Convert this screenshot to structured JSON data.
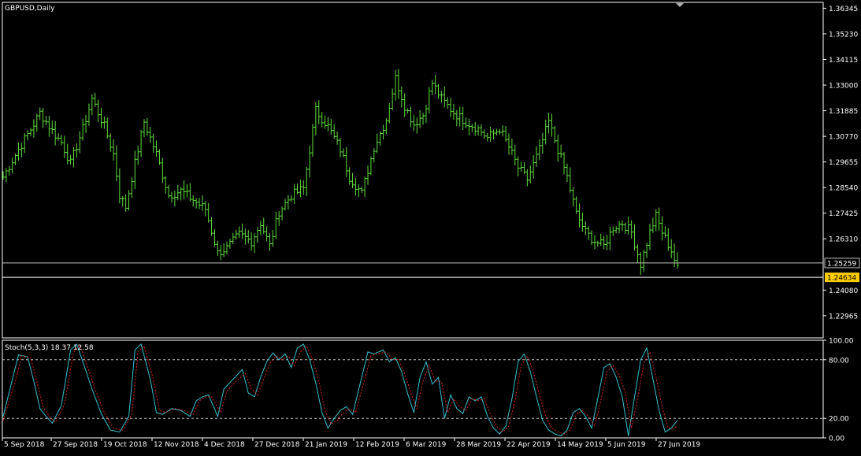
{
  "window": {
    "title": "GBPUSD,Daily"
  },
  "colors": {
    "background": "#000000",
    "foreground": "#ffffff",
    "bar": "#5fdc3b",
    "bid_line": "#c0c0c0",
    "ask_line": "#ffffff",
    "ask_badge": "#ffcc00",
    "stoch_main": "#35c0d0",
    "stoch_signal": "#e02020",
    "level_line": "#c0c0c0"
  },
  "chart_data": [
    {
      "type": "ohlc",
      "title": "GBPUSD,Daily",
      "ylim": [
        1.22,
        1.366
      ],
      "y_ticks": [
        "1.36345",
        "1.35230",
        "1.34115",
        "1.33000",
        "1.31885",
        "1.30770",
        "1.29655",
        "1.28540",
        "1.27425",
        "1.26310",
        "1.24080",
        "1.22965"
      ],
      "bid_label": "1.25259",
      "ask_label": "1.24634",
      "bid_price": 1.25259,
      "ask_price": 1.24634,
      "x_labels": [
        "5 Sep 2018",
        "27 Sep 2018",
        "19 Oct 2018",
        "12 Nov 2018",
        "4 Dec 2018",
        "27 Dec 2018",
        "21 Jan 2019",
        "12 Feb 2019",
        "6 Mar 2019",
        "28 Mar 2019",
        "22 Apr 2019",
        "14 May 2019",
        "5 Jun 2019",
        "27 Jun 2019"
      ],
      "close_anchors": [
        [
          0,
          1.29
        ],
        [
          5,
          1.302
        ],
        [
          10,
          1.313
        ],
        [
          12,
          1.318
        ],
        [
          16,
          1.31
        ],
        [
          19,
          1.305
        ],
        [
          22,
          1.296
        ],
        [
          26,
          1.311
        ],
        [
          29,
          1.324
        ],
        [
          33,
          1.312
        ],
        [
          36,
          1.3
        ],
        [
          38,
          1.282
        ],
        [
          40,
          1.277
        ],
        [
          43,
          1.296
        ],
        [
          46,
          1.314
        ],
        [
          50,
          1.3
        ],
        [
          54,
          1.282
        ],
        [
          58,
          1.284
        ],
        [
          62,
          1.28
        ],
        [
          66,
          1.276
        ],
        [
          70,
          1.257
        ],
        [
          73,
          1.259
        ],
        [
          77,
          1.265
        ],
        [
          81,
          1.262
        ],
        [
          84,
          1.27
        ],
        [
          87,
          1.26
        ],
        [
          90,
          1.275
        ],
        [
          94,
          1.282
        ],
        [
          98,
          1.285
        ],
        [
          102,
          1.319
        ],
        [
          106,
          1.312
        ],
        [
          110,
          1.302
        ],
        [
          113,
          1.29
        ],
        [
          117,
          1.283
        ],
        [
          121,
          1.303
        ],
        [
          125,
          1.315
        ],
        [
          128,
          1.333
        ],
        [
          131,
          1.321
        ],
        [
          134,
          1.313
        ],
        [
          137,
          1.317
        ],
        [
          140,
          1.331
        ],
        [
          143,
          1.324
        ],
        [
          147,
          1.318
        ],
        [
          151,
          1.314
        ],
        [
          155,
          1.311
        ],
        [
          158,
          1.307
        ],
        [
          162,
          1.311
        ],
        [
          165,
          1.303
        ],
        [
          168,
          1.294
        ],
        [
          171,
          1.289
        ],
        [
          175,
          1.302
        ],
        [
          178,
          1.314
        ],
        [
          181,
          1.302
        ],
        [
          184,
          1.29
        ],
        [
          187,
          1.274
        ],
        [
          190,
          1.266
        ],
        [
          193,
          1.262
        ],
        [
          196,
          1.26
        ],
        [
          199,
          1.268
        ],
        [
          202,
          1.27
        ],
        [
          205,
          1.266
        ],
        [
          208,
          1.252
        ],
        [
          211,
          1.266
        ],
        [
          213,
          1.273
        ],
        [
          215,
          1.266
        ],
        [
          218,
          1.258
        ],
        [
          220,
          1.25
        ]
      ]
    },
    {
      "type": "line",
      "title": "Stoch(5,3,3) 18.37 12.58",
      "main_value": 18.37,
      "signal_value": 12.58,
      "ylim": [
        0,
        100
      ],
      "y_ticks": [
        "100.00",
        "80.00",
        "20.00",
        "0.00"
      ],
      "levels": [
        80,
        20
      ],
      "series": [
        {
          "name": "Main",
          "anchors": [
            [
              0,
              22
            ],
            [
              3,
              60
            ],
            [
              5,
              85
            ],
            [
              8,
              83
            ],
            [
              10,
              58
            ],
            [
              12,
              30
            ],
            [
              14,
              22
            ],
            [
              16,
              15
            ],
            [
              19,
              33
            ],
            [
              22,
              90
            ],
            [
              24,
              96
            ],
            [
              26,
              78
            ],
            [
              29,
              50
            ],
            [
              32,
              25
            ],
            [
              35,
              8
            ],
            [
              38,
              6
            ],
            [
              41,
              22
            ],
            [
              43,
              90
            ],
            [
              45,
              96
            ],
            [
              48,
              60
            ],
            [
              50,
              26
            ],
            [
              52,
              24
            ],
            [
              55,
              30
            ],
            [
              58,
              28
            ],
            [
              61,
              22
            ],
            [
              63,
              38
            ],
            [
              65,
              42
            ],
            [
              67,
              44
            ],
            [
              70,
              22
            ],
            [
              72,
              50
            ],
            [
              75,
              60
            ],
            [
              78,
              70
            ],
            [
              80,
              46
            ],
            [
              82,
              42
            ],
            [
              84,
              62
            ],
            [
              86,
              78
            ],
            [
              88,
              87
            ],
            [
              90,
              80
            ],
            [
              92,
              86
            ],
            [
              94,
              72
            ],
            [
              96,
              92
            ],
            [
              98,
              96
            ],
            [
              100,
              80
            ],
            [
              102,
              56
            ],
            [
              104,
              26
            ],
            [
              106,
              10
            ],
            [
              108,
              20
            ],
            [
              110,
              28
            ],
            [
              112,
              32
            ],
            [
              114,
              24
            ],
            [
              117,
              62
            ],
            [
              119,
              88
            ],
            [
              121,
              86
            ],
            [
              124,
              90
            ],
            [
              126,
              78
            ],
            [
              128,
              82
            ],
            [
              130,
              68
            ],
            [
              132,
              45
            ],
            [
              134,
              26
            ],
            [
              136,
              62
            ],
            [
              138,
              78
            ],
            [
              140,
              55
            ],
            [
              142,
              62
            ],
            [
              144,
              20
            ],
            [
              146,
              44
            ],
            [
              148,
              30
            ],
            [
              150,
              25
            ],
            [
              152,
              42
            ],
            [
              154,
              38
            ],
            [
              156,
              42
            ],
            [
              158,
              22
            ],
            [
              160,
              10
            ],
            [
              162,
              4
            ],
            [
              164,
              12
            ],
            [
              166,
              40
            ],
            [
              168,
              78
            ],
            [
              170,
              86
            ],
            [
              172,
              68
            ],
            [
              174,
              42
            ],
            [
              176,
              18
            ],
            [
              178,
              8
            ],
            [
              180,
              4
            ],
            [
              182,
              2
            ],
            [
              184,
              8
            ],
            [
              186,
              26
            ],
            [
              188,
              30
            ],
            [
              190,
              22
            ],
            [
              192,
              10
            ],
            [
              194,
              40
            ],
            [
              196,
              72
            ],
            [
              198,
              76
            ],
            [
              200,
              62
            ],
            [
              202,
              42
            ],
            [
              204,
              2
            ],
            [
              206,
              42
            ],
            [
              208,
              80
            ],
            [
              210,
              92
            ],
            [
              212,
              60
            ],
            [
              214,
              28
            ],
            [
              216,
              6
            ],
            [
              218,
              10
            ],
            [
              220,
              18
            ]
          ]
        },
        {
          "name": "Signal",
          "anchors": [
            [
              0,
              18
            ],
            [
              4,
              58
            ],
            [
              6,
              84
            ],
            [
              9,
              82
            ],
            [
              11,
              58
            ],
            [
              13,
              32
            ],
            [
              15,
              22
            ],
            [
              17,
              16
            ],
            [
              20,
              34
            ],
            [
              23,
              88
            ],
            [
              25,
              95
            ],
            [
              27,
              78
            ],
            [
              30,
              50
            ],
            [
              33,
              26
            ],
            [
              36,
              10
            ],
            [
              39,
              8
            ],
            [
              42,
              24
            ],
            [
              44,
              88
            ],
            [
              46,
              94
            ],
            [
              49,
              60
            ],
            [
              51,
              28
            ],
            [
              53,
              26
            ],
            [
              56,
              30
            ],
            [
              59,
              28
            ],
            [
              62,
              24
            ],
            [
              64,
              38
            ],
            [
              66,
              42
            ],
            [
              68,
              42
            ],
            [
              71,
              26
            ],
            [
              73,
              48
            ],
            [
              76,
              58
            ],
            [
              79,
              66
            ],
            [
              81,
              50
            ],
            [
              83,
              44
            ],
            [
              85,
              60
            ],
            [
              87,
              76
            ],
            [
              89,
              84
            ],
            [
              91,
              80
            ],
            [
              93,
              84
            ],
            [
              95,
              74
            ],
            [
              97,
              88
            ],
            [
              99,
              94
            ],
            [
              101,
              80
            ],
            [
              103,
              58
            ],
            [
              105,
              28
            ],
            [
              107,
              14
            ],
            [
              109,
              18
            ],
            [
              111,
              26
            ],
            [
              113,
              30
            ],
            [
              115,
              26
            ],
            [
              118,
              60
            ],
            [
              120,
              84
            ],
            [
              122,
              86
            ],
            [
              125,
              88
            ],
            [
              127,
              80
            ],
            [
              129,
              80
            ],
            [
              131,
              66
            ],
            [
              133,
              46
            ],
            [
              135,
              30
            ],
            [
              137,
              58
            ],
            [
              139,
              74
            ],
            [
              141,
              58
            ],
            [
              143,
              58
            ],
            [
              145,
              26
            ],
            [
              147,
              40
            ],
            [
              149,
              32
            ],
            [
              151,
              28
            ],
            [
              153,
              40
            ],
            [
              155,
              38
            ],
            [
              157,
              40
            ],
            [
              159,
              24
            ],
            [
              161,
              12
            ],
            [
              163,
              6
            ],
            [
              165,
              12
            ],
            [
              167,
              38
            ],
            [
              169,
              74
            ],
            [
              171,
              84
            ],
            [
              173,
              68
            ],
            [
              175,
              44
            ],
            [
              177,
              22
            ],
            [
              179,
              10
            ],
            [
              181,
              6
            ],
            [
              183,
              4
            ],
            [
              185,
              8
            ],
            [
              187,
              24
            ],
            [
              189,
              28
            ],
            [
              191,
              22
            ],
            [
              193,
              12
            ],
            [
              195,
              38
            ],
            [
              197,
              68
            ],
            [
              199,
              74
            ],
            [
              201,
              64
            ],
            [
              203,
              46
            ],
            [
              205,
              10
            ],
            [
              207,
              40
            ],
            [
              209,
              76
            ],
            [
              211,
              88
            ],
            [
              213,
              62
            ],
            [
              215,
              32
            ],
            [
              217,
              10
            ],
            [
              219,
              10
            ],
            [
              220,
              12.58
            ]
          ]
        }
      ]
    }
  ]
}
